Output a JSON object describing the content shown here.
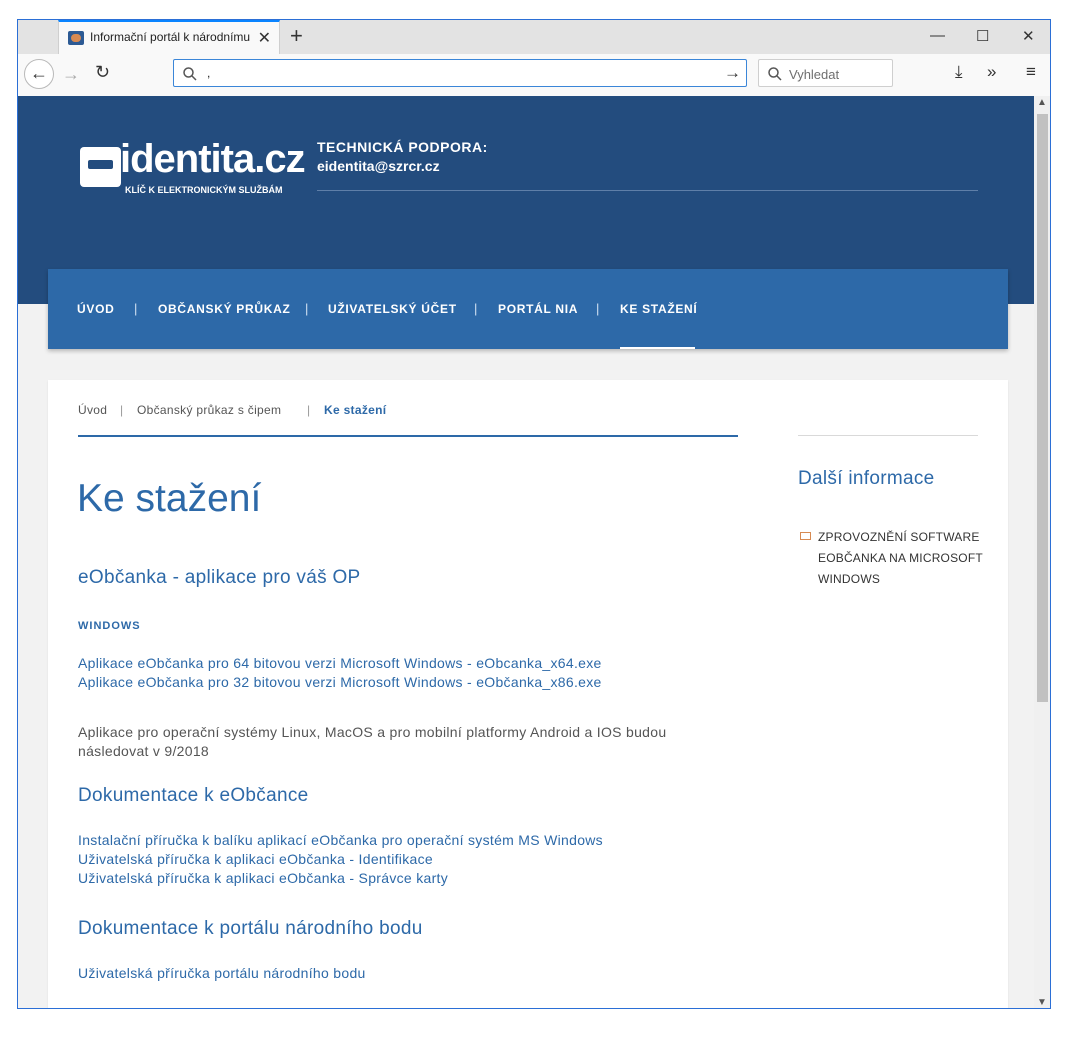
{
  "browser": {
    "tab_title": "Informační portál k národnímu",
    "url": ",",
    "search_placeholder": "Vyhledat"
  },
  "header": {
    "logo_text": "identita.cz",
    "logo_sub": "KLÍČ K ELEKTRONICKÝM SLUŽBÁM",
    "support_title": "TECHNICKÁ PODPORA:",
    "support_email": "eidentita@szrcr.cz"
  },
  "nav": {
    "items": [
      "ÚVOD",
      "OBČANSKÝ PRŮKAZ",
      "UŽIVATELSKÝ ÚČET",
      "PORTÁL NIA",
      "KE STAŽENÍ"
    ],
    "separator": "|",
    "active": "KE STAŽENÍ"
  },
  "breadcrumb": {
    "items": [
      "Úvod",
      "Občanský průkaz s čipem",
      "Ke stažení"
    ],
    "separator": "|"
  },
  "main": {
    "title": "Ke stažení",
    "section1": {
      "heading": "eObčanka - aplikace pro váš OP",
      "subheading": "WINDOWS",
      "links": [
        "Aplikace eObčanka pro 64 bitovou verzi Microsoft Windows - eObcanka_x64.exe",
        "Aplikace eObčanka pro 32 bitovou verzi Microsoft Windows - eObčanka_x86.exe"
      ],
      "note": "Aplikace pro operační systémy Linux, MacOS a pro mobilní platformy Android a IOS budou následovat v 9/2018"
    },
    "section2": {
      "heading": "Dokumentace k eObčance",
      "links": [
        "Instalační příručka k balíku aplikací eObčanka pro operační systém MS Windows",
        "Uživatelská příručka k aplikaci eObčanka - Identifikace",
        "Uživatelská příručka k aplikaci eObčanka - Správce karty"
      ]
    },
    "section3": {
      "heading": "Dokumentace k portálu národního bodu",
      "links": [
        "Uživatelská příručka portálu národního bodu"
      ]
    }
  },
  "sidebar": {
    "title": "Další informace",
    "link": "ZPROVOZNĚNÍ SOFTWARE EOBČANKA NA MICROSOFT WINDOWS"
  },
  "colors": {
    "header_bg": "#234c7e",
    "nav_bg": "#2d69a8",
    "accent": "#2d69a8",
    "icon_orange": "#d78a52"
  }
}
